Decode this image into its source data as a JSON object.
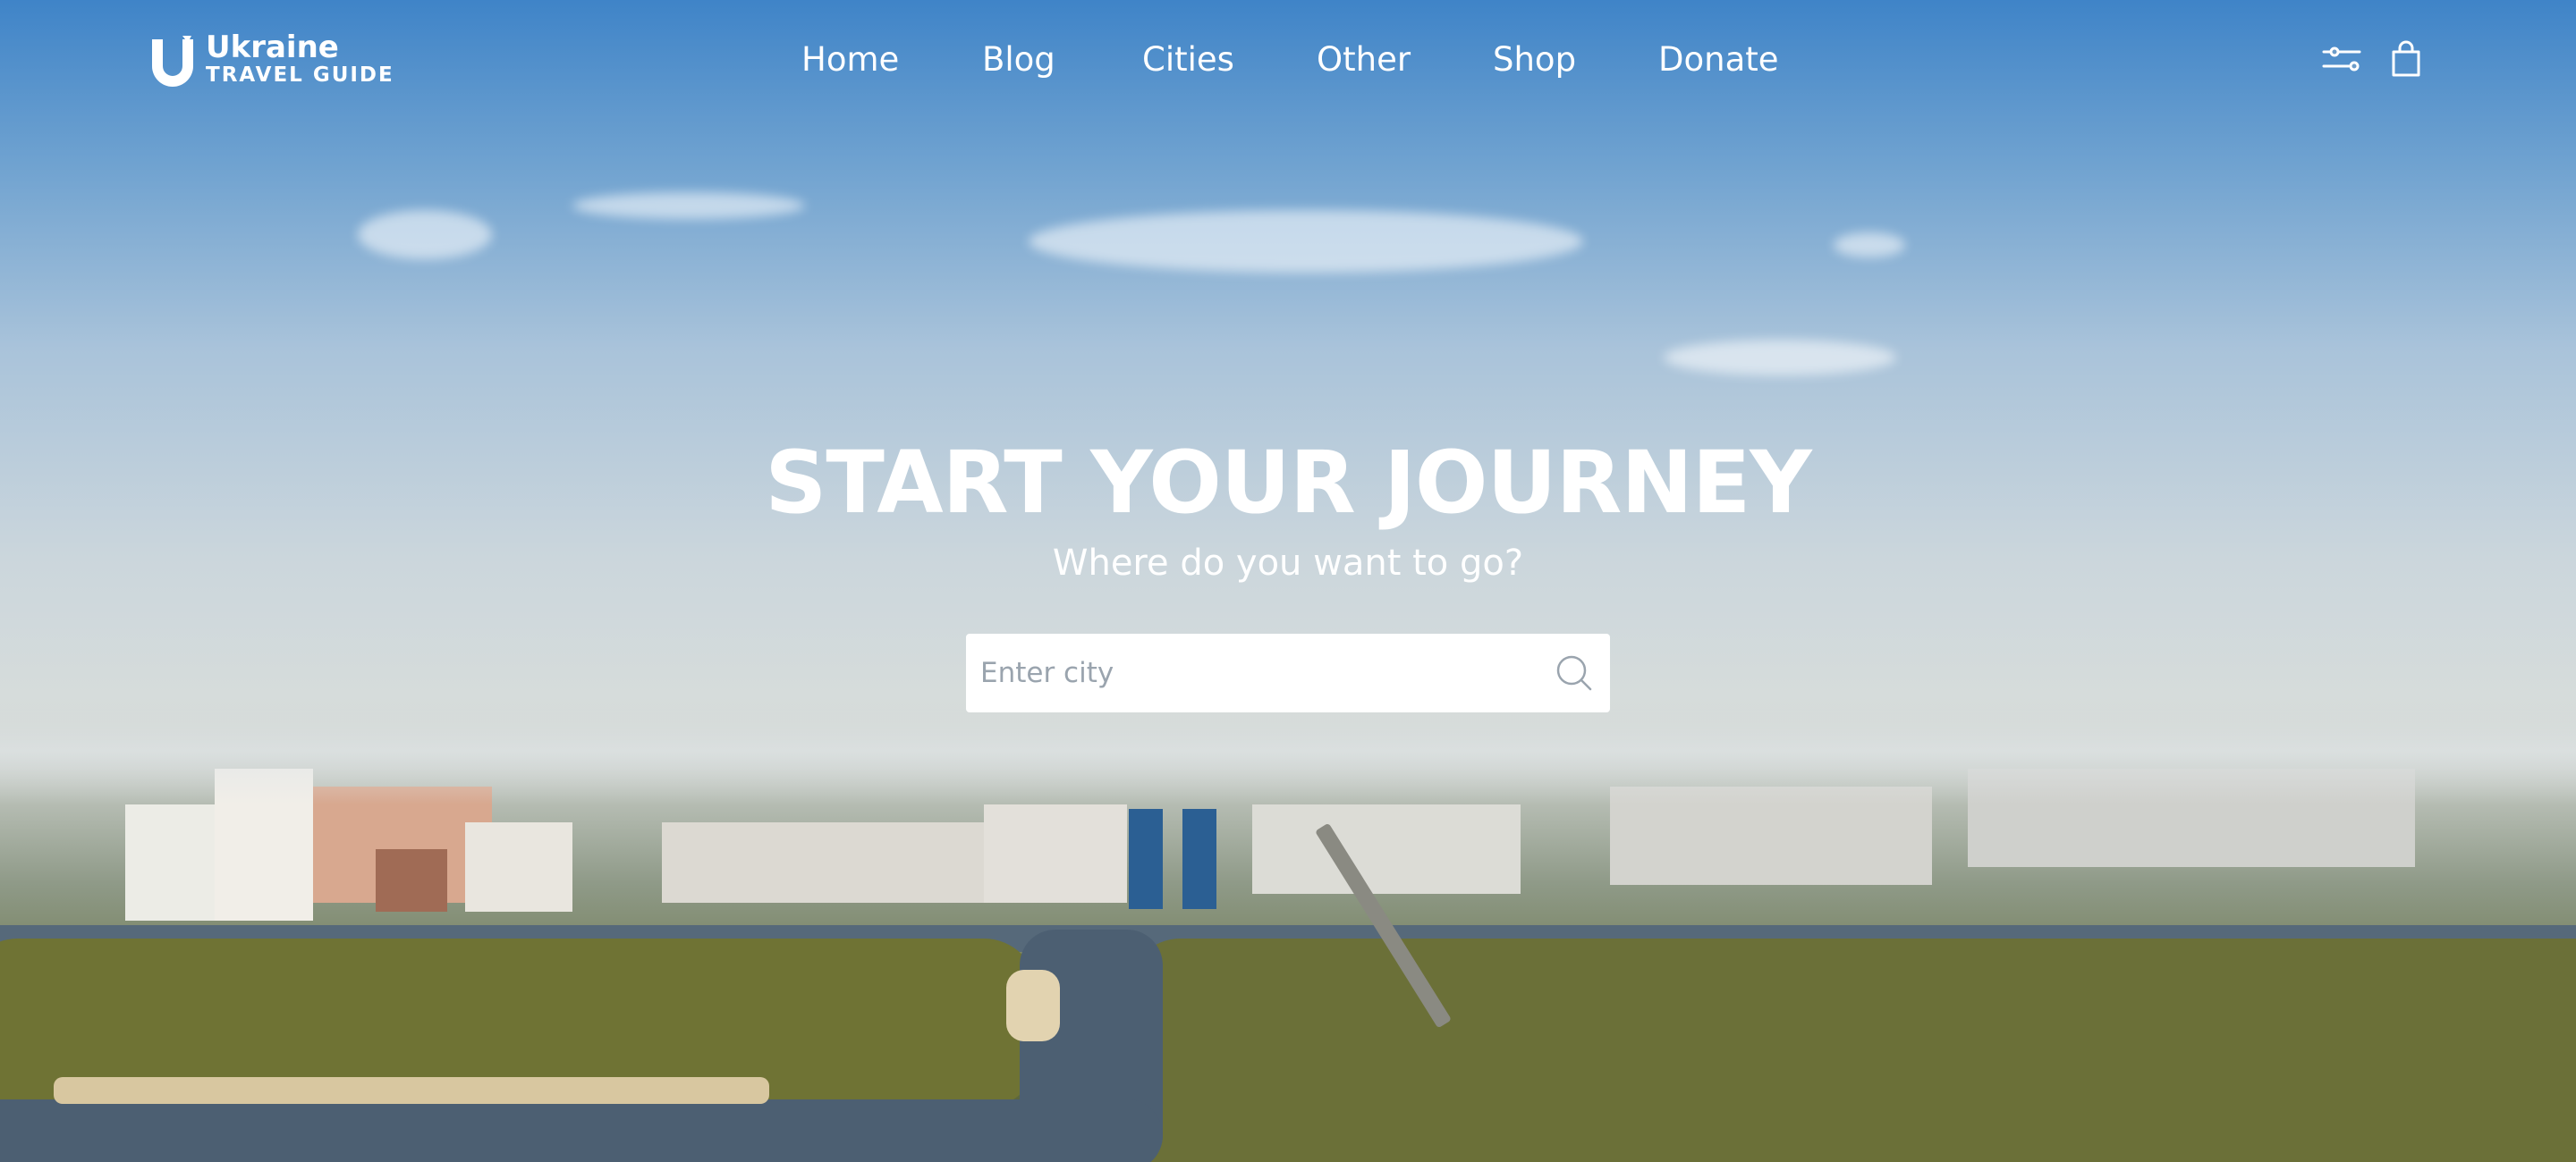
{
  "brand": {
    "title": "Ukraine",
    "subtitle": "TRAVEL GUIDE"
  },
  "nav": {
    "items": [
      "Home",
      "Blog",
      "Cities",
      "Other",
      "Shop",
      "Donate"
    ]
  },
  "header_icons": [
    "filter-icon",
    "shopping-bag-icon"
  ],
  "hero": {
    "title": "START YOUR JOURNEY",
    "subtitle": "Where do you want to go?"
  },
  "search": {
    "placeholder": "Enter city",
    "value": ""
  },
  "colors": {
    "text": "#ffffff",
    "search_bg": "#ffffff",
    "placeholder": "#9aa4ae",
    "sky": "#3f84c8"
  }
}
